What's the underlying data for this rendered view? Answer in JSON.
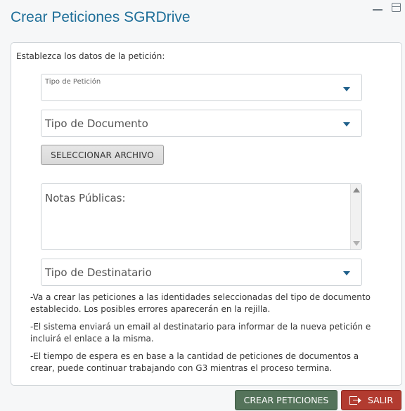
{
  "window": {
    "minimize_icon": "minimize-icon",
    "maximize_icon": "maximize-icon"
  },
  "title": "Crear Peticiones SGRDrive",
  "form": {
    "instruction": "Establezca los datos de la petición:",
    "tipo_peticion": {
      "label": "Tipo de Petición",
      "value": ""
    },
    "tipo_documento": {
      "label": "Tipo de Documento",
      "value": ""
    },
    "select_file_label": "SELECCIONAR ARCHIVO",
    "notas_placeholder": "Notas Públicas:",
    "tipo_destinatario": {
      "label": "Tipo de Destinatario",
      "value": ""
    }
  },
  "messages": [
    "-Va a crear las peticiones a las identidades seleccionadas del tipo de documento establecido. Los posibles errores aparecerán en la rejilla.",
    "-El sistema enviará un email al destinatario para informar de la nueva petición e incluirá el enlace a la misma.",
    "-El tiempo de espera es en base a la cantidad de peticiones de documentos a crear, puede continuar trabajando con G3 mientras el proceso termina."
  ],
  "footer": {
    "create_label": "CREAR PETICIONES",
    "exit_label": "SALIR"
  },
  "colors": {
    "title": "#1f6f99",
    "create_button": "#54735a",
    "exit_button": "#b23b30",
    "caret": "#1e5f8a"
  }
}
